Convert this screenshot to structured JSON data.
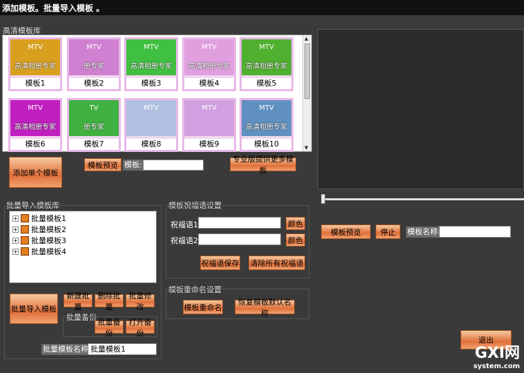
{
  "title": "添加模板。批量导入模板 。",
  "gallery": {
    "label": "高清模板库",
    "items": [
      {
        "name": "模板1",
        "mtv": "MTV",
        "caption": "高清相册专家",
        "color": "#d9a020"
      },
      {
        "name": "模板2",
        "mtv": "MTV",
        "caption": "册专家",
        "color": "#d080d0"
      },
      {
        "name": "模板3",
        "mtv": "MTV",
        "caption": "高清相册专家",
        "color": "#40c040"
      },
      {
        "name": "模板4",
        "mtv": "MTV",
        "caption": "高清相册专家",
        "color": "#e0a0e0"
      },
      {
        "name": "模板5",
        "mtv": "MTV",
        "caption": "高清相册专家",
        "color": "#50b030"
      },
      {
        "name": "模板6",
        "mtv": "MTV",
        "caption": "高清相册专家",
        "color": "#c020c0"
      },
      {
        "name": "模板7",
        "mtv": "TV",
        "caption": "册专家",
        "color": "#40b040"
      },
      {
        "name": "模板8",
        "mtv": "MTV",
        "caption": "",
        "color": "#b0c0e0"
      },
      {
        "name": "模板9",
        "mtv": "MTV",
        "caption": "",
        "color": "#d0a0e0"
      },
      {
        "name": "模板10",
        "mtv": "MTV",
        "caption": "高清相册专家",
        "color": "#6090c0"
      }
    ]
  },
  "buttons": {
    "add_single": "添加单个模板",
    "preview_tpl": "模板预览",
    "more_tpl": "专业版提供更多模板",
    "batch_import": "批量导入模板",
    "new_batch": "新建批量",
    "del_batch": "删除批量",
    "edit_batch": "批量修改",
    "backup": "批量备份",
    "open_backup": "打开备份",
    "color1": "颜色",
    "color2": "颜色",
    "save_greeting": "祝福语保存",
    "clear_greeting": "清除所有祝福语",
    "rename": "模板重命名",
    "restore_name": "恢复模板默认名称",
    "right_preview": "模板预览",
    "stop": "停止",
    "exit": "退出"
  },
  "labels": {
    "template": "模板:",
    "batch_lib": "批量导入模板库",
    "greeting_settings": "模板祝福语设置",
    "greeting1": "祝福语1:",
    "greeting2": "祝福语2:",
    "rename_settings": "模板重命名设置",
    "batch_backup_group": "批量备份",
    "batch_name": "批量模板名称:",
    "tpl_name": "模板名称:"
  },
  "inputs": {
    "template_value": "",
    "greeting1_value": "",
    "greeting2_value": "",
    "batch_name_value": "批量模板1",
    "tpl_name_value": ""
  },
  "tree": [
    "批量模板1",
    "批量模板2",
    "批量模板3",
    "批量模板4"
  ],
  "watermark": {
    "main": "GXI网",
    "sub": "system.com"
  }
}
